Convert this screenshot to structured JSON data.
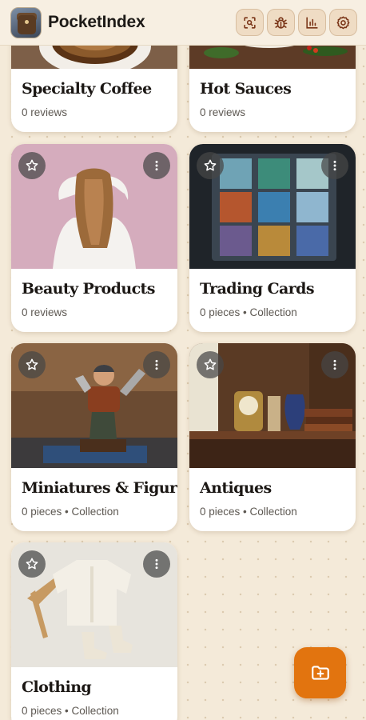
{
  "app": {
    "title": "PocketIndex"
  },
  "header_actions": [
    {
      "name": "scan-button",
      "icon": "scan-icon"
    },
    {
      "name": "bug-report-button",
      "icon": "bug-icon"
    },
    {
      "name": "stats-button",
      "icon": "bar-chart-icon"
    },
    {
      "name": "settings-button",
      "icon": "gear-icon"
    }
  ],
  "collections": [
    {
      "title": "Specialty Coffee",
      "meta": "0 reviews"
    },
    {
      "title": "Hot Sauces",
      "meta": "0 reviews"
    },
    {
      "title": "Beauty Products",
      "meta": "0 reviews"
    },
    {
      "title": "Trading Cards",
      "meta": "0 pieces • Collection"
    },
    {
      "title": "Miniatures & Figurines",
      "meta": "0 pieces • Collection"
    },
    {
      "title": "Antiques",
      "meta": "0 pieces • Collection"
    },
    {
      "title": "Clothing",
      "meta": "0 pieces • Collection"
    }
  ],
  "fab": {
    "icon": "add-folder-icon"
  },
  "colors": {
    "accent": "#e2740f",
    "background": "#f4ead9",
    "icon": "#7a3518"
  }
}
